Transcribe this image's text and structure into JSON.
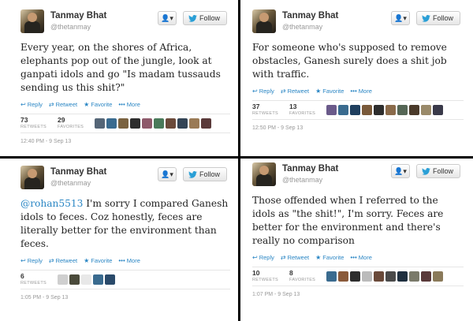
{
  "tweets": [
    {
      "user": {
        "name": "Tanmay Bhat",
        "handle": "@thetanmay"
      },
      "buttons": {
        "user": "👤▾",
        "follow": "Follow"
      },
      "mention": "",
      "text": "Every year, on the shores of Africa, elephants pop out of the jungle, look at ganpati idols and go \"Is madam tussauds sending us this shit?\"",
      "actions": {
        "reply": "Reply",
        "retweet": "Retweet",
        "favorite": "Favorite",
        "more": "More"
      },
      "stats": {
        "retweets": "73",
        "retweets_label": "RETWEETS",
        "favorites": "29",
        "favorites_label": "FAVORITES"
      },
      "face_colors": [
        "#556677",
        "#3a6b8f",
        "#7a6240",
        "#2d2d2d",
        "#8e5a6b",
        "#4a7a5a",
        "#6b4a3a",
        "#334455",
        "#9a7a55",
        "#5a3a3a"
      ],
      "timestamp": "12:40 PM - 9 Sep 13"
    },
    {
      "user": {
        "name": "Tanmay Bhat",
        "handle": "@thetanmay"
      },
      "buttons": {
        "user": "👤▾",
        "follow": "Follow"
      },
      "mention": "",
      "text": "For someone who's supposed to remove obstacles, Ganesh surely does a shit job with traffic.",
      "actions": {
        "reply": "Reply",
        "retweet": "Retweet",
        "favorite": "Favorite",
        "more": "More"
      },
      "stats": {
        "retweets": "37",
        "retweets_label": "RETWEETS",
        "favorites": "13",
        "favorites_label": "FAVORITES"
      },
      "face_colors": [
        "#6a5a8a",
        "#3a6b8f",
        "#1f3f5f",
        "#7a5a3a",
        "#2d2d2d",
        "#8a6a4a",
        "#556655",
        "#4a3a2a",
        "#9a8a6a",
        "#3a3a4a"
      ],
      "timestamp": "12:50 PM - 9 Sep 13"
    },
    {
      "user": {
        "name": "Tanmay Bhat",
        "handle": "@thetanmay"
      },
      "buttons": {
        "user": "👤▾",
        "follow": "Follow"
      },
      "mention": "@rohan5513",
      "text": " I'm sorry I compared Ganesh idols to feces. Coz honestly, feces are literally better for the environment than feces.",
      "actions": {
        "reply": "Reply",
        "retweet": "Retweet",
        "favorite": "Favorite",
        "more": "More"
      },
      "stats": {
        "retweets": "6",
        "retweets_label": "RETWEETS"
      },
      "face_colors": [
        "#cfcfcf",
        "#4a4a3a",
        "#e8e8e8",
        "#3a6b8f",
        "#2a4a6a"
      ],
      "timestamp": "1:05 PM - 9 Sep 13"
    },
    {
      "user": {
        "name": "Tanmay Bhat",
        "handle": "@thetanmay"
      },
      "buttons": {
        "user": "👤▾",
        "follow": "Follow"
      },
      "mention": "",
      "text": "Those offended when I referred to the idols as \"the shit!\", I'm sorry. Feces are better for the environment and there's really no comparison",
      "actions": {
        "reply": "Reply",
        "retweet": "Retweet",
        "favorite": "Favorite",
        "more": "More"
      },
      "stats": {
        "retweets": "10",
        "retweets_label": "RETWEETS",
        "favorites": "8",
        "favorites_label": "FAVORITES"
      },
      "face_colors": [
        "#3a6b8f",
        "#8a5a3a",
        "#2d2d2d",
        "#bbbbbb",
        "#6a4a3a",
        "#4a4a4a",
        "#1f2f3f",
        "#7a7a6a",
        "#5a3a3a",
        "#8a7a5a"
      ],
      "timestamp": "1:07 PM - 9 Sep 13"
    }
  ]
}
